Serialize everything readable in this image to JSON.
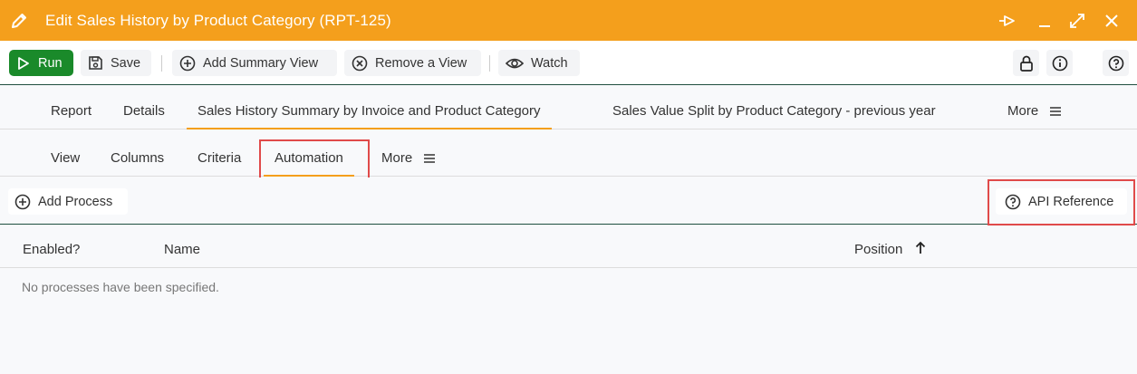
{
  "window": {
    "title": "Edit Sales History by Product Category (RPT-125)",
    "controls": [
      "pin-icon",
      "minimize-icon",
      "maximize-icon",
      "close-icon"
    ]
  },
  "toolbar": {
    "run_label": "Run",
    "save_label": "Save",
    "add_summary_label": "Add Summary View",
    "remove_view_label": "Remove a View",
    "watch_label": "Watch",
    "right_icons": [
      "lock-icon",
      "info-icon",
      "help-icon"
    ]
  },
  "tabs_primary": [
    {
      "label": "Report",
      "active": false
    },
    {
      "label": "Details",
      "active": false
    },
    {
      "label": "Sales History Summary by Invoice and Product Category",
      "active": true
    },
    {
      "label": "Sales Value Split by Product Category - previous year",
      "active": false
    },
    {
      "label": "More",
      "active": false
    }
  ],
  "tabs_secondary": [
    {
      "label": "View",
      "active": false
    },
    {
      "label": "Columns",
      "active": false
    },
    {
      "label": "Criteria",
      "active": false
    },
    {
      "label": "Automation",
      "active": true
    },
    {
      "label": "More",
      "active": false
    }
  ],
  "actions": {
    "add_process_label": "Add Process",
    "api_reference_label": "API Reference"
  },
  "table": {
    "columns": [
      "Enabled?",
      "Name",
      "Position"
    ],
    "sort_column": "Position",
    "sort_direction": "ascending",
    "empty_message": "No processes have been specified."
  },
  "colors": {
    "title_bar": "#f49f1c",
    "run_button": "#1a8a2a",
    "active_tab_underline": "#f49f1c",
    "highlight_box": "#e04a4a"
  }
}
